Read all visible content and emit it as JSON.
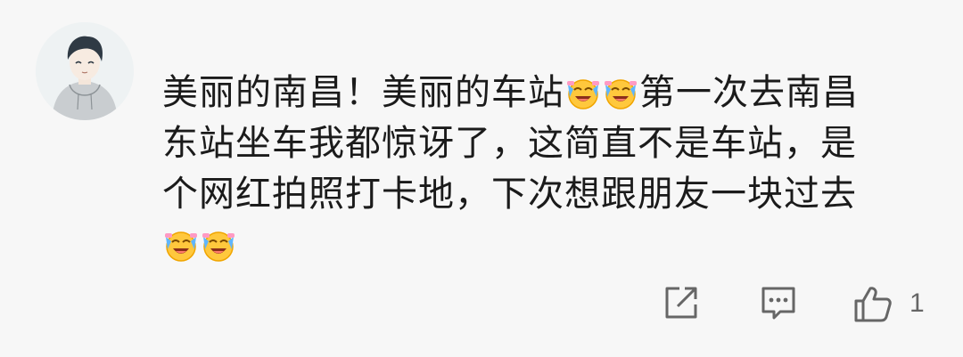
{
  "comment": {
    "line1_a": "美丽的南昌！美丽的车站",
    "line1_b": "第一次去南昌",
    "line2": "东站坐车我都惊讶了，这简直不是车站，是",
    "line3": "个网红拍照打卡地，下次想跟朋友一块过去",
    "emoji_name": "crying-laughing-emoji"
  },
  "actions": {
    "share_icon": "share-icon",
    "reply_icon": "reply-icon",
    "like_icon": "thumbs-up-icon",
    "like_count": "1"
  },
  "colors": {
    "background": "#f7f7f7",
    "text": "#1b1b1b",
    "icon": "#666666"
  }
}
